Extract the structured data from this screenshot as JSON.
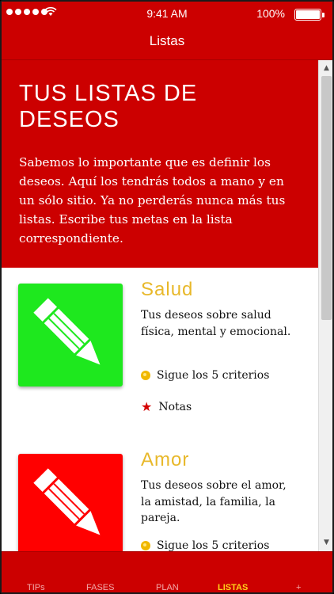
{
  "status_bar": {
    "time": "9:41 AM",
    "battery": "100%"
  },
  "nav": {
    "title": "Listas"
  },
  "hero": {
    "title": "TUS LISTAS DE DESEOS",
    "text": "Sabemos lo importante que es definir los deseos. Aquí los tendrás todos a mano y en un sólo sitio. Ya no perderás nunca más tus listas. Escribe tus metas en la lista correspondiente."
  },
  "cards": [
    {
      "title": "Salud",
      "description": "Tus deseos sobre salud física, mental y emocional.",
      "criteria": "Sigue los 5 criterios",
      "notes": "Notas",
      "color": "#1ee81e"
    },
    {
      "title": "Amor",
      "description": "Tus deseos sobre el amor, la amistad, la familia, la pareja.",
      "criteria": "Sigue los 5 criterios",
      "color": "#ff0000"
    }
  ],
  "tabs": [
    {
      "label": "TIPs"
    },
    {
      "label": "FASES"
    },
    {
      "label": "PLAN"
    },
    {
      "label": "LISTAS"
    },
    {
      "label": "+"
    }
  ],
  "colors": {
    "brand": "#cc0000",
    "accent": "#e8b82a",
    "active_tab": "#ffd21a"
  }
}
